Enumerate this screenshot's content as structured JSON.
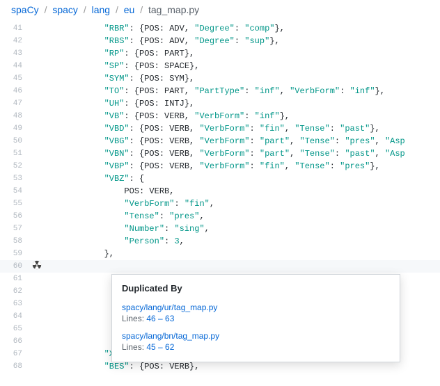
{
  "breadcrumb": {
    "items": [
      "spaCy",
      "spacy",
      "lang",
      "eu"
    ],
    "file": "tag_map.py"
  },
  "lines": [
    {
      "n": 41,
      "dup": [
        "a"
      ],
      "indent": "        ",
      "html": "<span class='tok-str'>\"RBR\"</span>: {POS: ADV, <span class='tok-str'>\"Degree\"</span>: <span class='tok-str'>\"comp\"</span>},"
    },
    {
      "n": 42,
      "dup": [
        "a"
      ],
      "indent": "        ",
      "html": "<span class='tok-str'>\"RBS\"</span>: {POS: ADV, <span class='tok-str'>\"Degree\"</span>: <span class='tok-str'>\"sup\"</span>},"
    },
    {
      "n": 43,
      "dup": [
        "a"
      ],
      "indent": "        ",
      "html": "<span class='tok-str'>\"RP\"</span>: {POS: PART},"
    },
    {
      "n": 44,
      "dup": [
        "a"
      ],
      "indent": "        ",
      "html": "<span class='tok-str'>\"SP\"</span>: {POS: SPACE},"
    },
    {
      "n": 45,
      "dup": [
        "a",
        "b"
      ],
      "indent": "        ",
      "html": "<span class='tok-str'>\"SYM\"</span>: {POS: SYM},"
    },
    {
      "n": 46,
      "dup": [
        "a",
        "b",
        "c"
      ],
      "indent": "        ",
      "html": "<span class='tok-str'>\"TO\"</span>: {POS: PART, <span class='tok-str'>\"PartType\"</span>: <span class='tok-str'>\"inf\"</span>, <span class='tok-str'>\"VerbForm\"</span>: <span class='tok-str'>\"inf\"</span>},"
    },
    {
      "n": 47,
      "dup": [
        "a",
        "b",
        "c"
      ],
      "indent": "        ",
      "html": "<span class='tok-str'>\"UH\"</span>: {POS: INTJ},"
    },
    {
      "n": 48,
      "dup": [
        "a",
        "b",
        "c"
      ],
      "indent": "        ",
      "html": "<span class='tok-str'>\"VB\"</span>: {POS: VERB, <span class='tok-str'>\"VerbForm\"</span>: <span class='tok-str'>\"inf\"</span>},"
    },
    {
      "n": 49,
      "dup": [
        "a",
        "b",
        "c"
      ],
      "indent": "        ",
      "html": "<span class='tok-str'>\"VBD\"</span>: {POS: VERB, <span class='tok-str'>\"VerbForm\"</span>: <span class='tok-str'>\"fin\"</span>, <span class='tok-str'>\"Tense\"</span>: <span class='tok-str'>\"past\"</span>},"
    },
    {
      "n": 50,
      "dup": [
        "a",
        "b",
        "c"
      ],
      "indent": "        ",
      "html": "<span class='tok-str'>\"VBG\"</span>: {POS: VERB, <span class='tok-str'>\"VerbForm\"</span>: <span class='tok-str'>\"part\"</span>, <span class='tok-str'>\"Tense\"</span>: <span class='tok-str'>\"pres\"</span>, <span class='tok-str'>\"Asp</span>"
    },
    {
      "n": 51,
      "dup": [
        "a",
        "b",
        "c"
      ],
      "indent": "        ",
      "html": "<span class='tok-str'>\"VBN\"</span>: {POS: VERB, <span class='tok-str'>\"VerbForm\"</span>: <span class='tok-str'>\"part\"</span>, <span class='tok-str'>\"Tense\"</span>: <span class='tok-str'>\"past\"</span>, <span class='tok-str'>\"Asp</span>"
    },
    {
      "n": 52,
      "dup": [
        "a",
        "b",
        "c"
      ],
      "indent": "        ",
      "html": "<span class='tok-str'>\"VBP\"</span>: {POS: VERB, <span class='tok-str'>\"VerbForm\"</span>: <span class='tok-str'>\"fin\"</span>, <span class='tok-str'>\"Tense\"</span>: <span class='tok-str'>\"pres\"</span>},"
    },
    {
      "n": 53,
      "dup": [
        "a",
        "b",
        "c"
      ],
      "indent": "        ",
      "html": "<span class='tok-str'>\"VBZ\"</span>: {"
    },
    {
      "n": 54,
      "dup": [
        "a",
        "b",
        "c"
      ],
      "indent": "            ",
      "html": "POS: VERB,"
    },
    {
      "n": 55,
      "dup": [
        "a",
        "b",
        "c"
      ],
      "indent": "            ",
      "html": "<span class='tok-str'>\"VerbForm\"</span>: <span class='tok-str'>\"fin\"</span>,"
    },
    {
      "n": 56,
      "dup": [
        "a",
        "b",
        "c"
      ],
      "indent": "            ",
      "html": "<span class='tok-str'>\"Tense\"</span>: <span class='tok-str'>\"pres\"</span>,"
    },
    {
      "n": 57,
      "dup": [
        "a",
        "b",
        "c"
      ],
      "indent": "            ",
      "html": "<span class='tok-str'>\"Number\"</span>: <span class='tok-str'>\"sing\"</span>,"
    },
    {
      "n": 58,
      "dup": [
        "a",
        "b",
        "c"
      ],
      "indent": "            ",
      "html": "<span class='tok-str'>\"Person\"</span>: <span class='tok-num'>3</span>,"
    },
    {
      "n": 59,
      "dup": [
        "a",
        "b",
        "c"
      ],
      "indent": "        ",
      "html": "},"
    },
    {
      "n": 60,
      "dup": [
        "a",
        "b",
        "c"
      ],
      "hl": true,
      "icon": true,
      "indent": "        ",
      "html": ""
    },
    {
      "n": 61,
      "dup": [
        "a",
        "b",
        "c"
      ],
      "indent": "        ",
      "html": ""
    },
    {
      "n": 62,
      "dup": [
        "a",
        "b",
        "c"
      ],
      "indent": "        ",
      "html": "                                               <span class='tok-str'>\"</span>},"
    },
    {
      "n": 63,
      "dup": [
        "a",
        "b",
        "c"
      ],
      "indent": "        ",
      "html": ""
    },
    {
      "n": 64,
      "dup": [],
      "indent": "        ",
      "html": ""
    },
    {
      "n": 65,
      "dup": [],
      "indent": "        ",
      "html": ""
    },
    {
      "n": 66,
      "dup": [],
      "indent": "        ",
      "html": ""
    },
    {
      "n": 67,
      "dup": [],
      "indent": "        ",
      "html": "<span class='tok-str'>\"XX\"</span>: {POS: X},"
    },
    {
      "n": 68,
      "dup": [],
      "indent": "        ",
      "html": "<span class='tok-str'>\"BES\"</span>: {POS: VERB},"
    }
  ],
  "popup": {
    "title": "Duplicated By",
    "items": [
      {
        "path": "spacy/lang/ur/tag_map.py",
        "lines_label": "Lines: ",
        "lines_range": "46 – 63"
      },
      {
        "path": "spacy/lang/bn/tag_map.py",
        "lines_label": "Lines: ",
        "lines_range": "45 – 62"
      }
    ]
  }
}
